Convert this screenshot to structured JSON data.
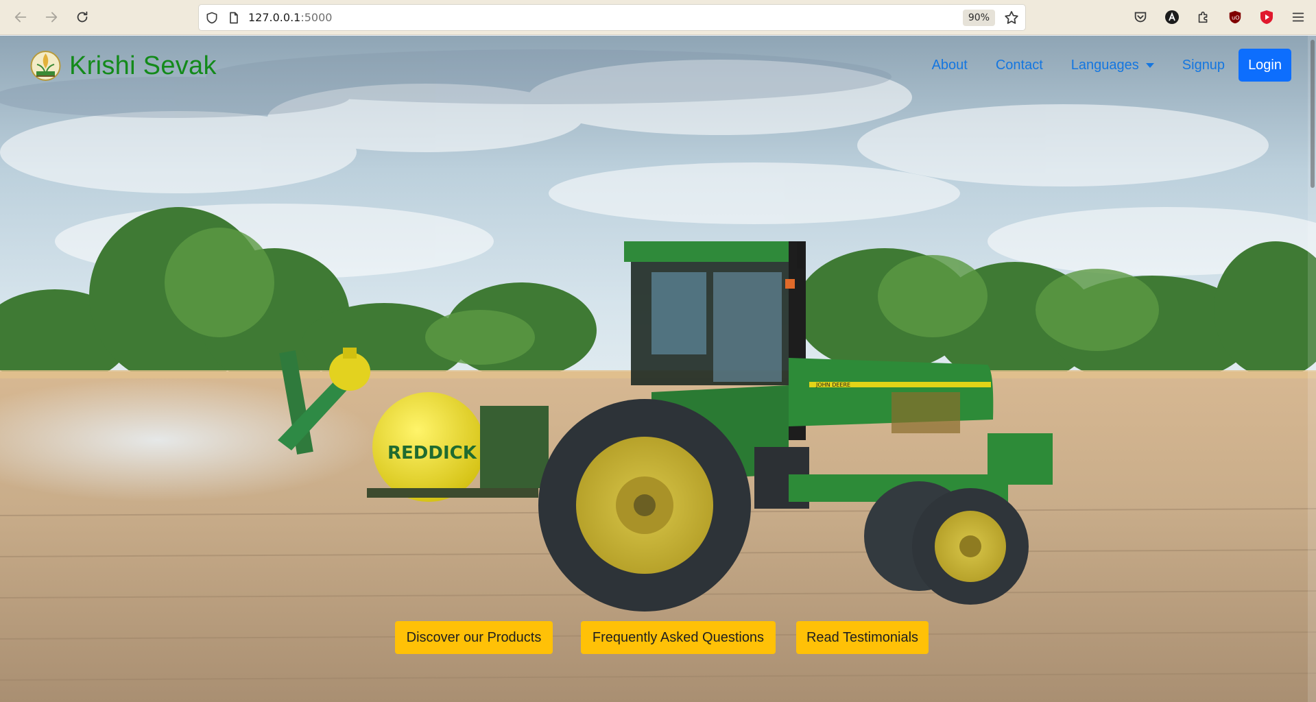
{
  "browser": {
    "url_host": "127.0.0.1",
    "url_port": ":5000",
    "zoom": "90%"
  },
  "site": {
    "brand": "Krishi Sevak",
    "nav": {
      "about": "About",
      "contact": "Contact",
      "languages": "Languages",
      "signup": "Signup",
      "login": "Login"
    },
    "cta": {
      "products": "Discover our Products",
      "faq": "Frequently Asked Questions",
      "testimonials": "Read Testimonials"
    },
    "hero_image": {
      "tank_text": "REDDICK",
      "tractor_badge": "JOHN DEERE"
    }
  },
  "colors": {
    "brand_green": "#138a1a",
    "link_blue": "#1476e0",
    "login_blue": "#0d6efd",
    "cta_yellow": "#ffc107"
  }
}
